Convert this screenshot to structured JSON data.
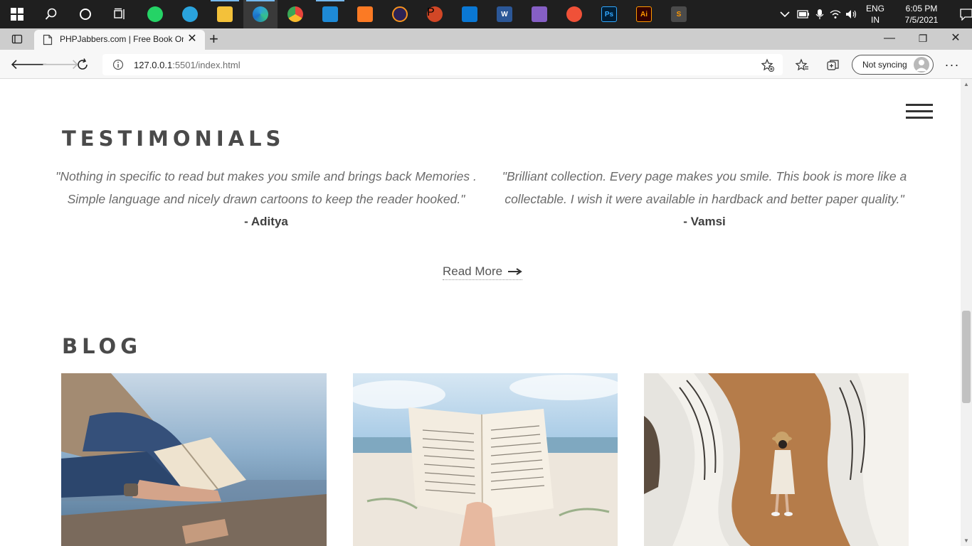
{
  "taskbar": {
    "apps": [
      {
        "name": "windows-start-icon"
      },
      {
        "name": "search-icon"
      },
      {
        "name": "cortana-icon"
      },
      {
        "name": "task-view-icon"
      },
      {
        "name": "whatsapp-icon",
        "color": "#25d366"
      },
      {
        "name": "telegram-icon",
        "color": "#2aa3dd"
      },
      {
        "name": "file-explorer-icon",
        "color": "#f3c13a"
      },
      {
        "name": "edge-icon",
        "color": "#2fa0d8"
      },
      {
        "name": "chrome-icon",
        "color": "#e8453c"
      },
      {
        "name": "vscode-icon",
        "color": "#1e8ad6"
      },
      {
        "name": "xampp-icon",
        "color": "#fb7a24"
      },
      {
        "name": "eclipse-icon",
        "color": "#2c2255"
      },
      {
        "name": "powerpoint-icon",
        "color": "#d24726",
        "glyph": "P"
      },
      {
        "name": "mail-icon",
        "color": "#0a78d4"
      },
      {
        "name": "word-icon",
        "color": "#2b5797",
        "glyph": "W"
      },
      {
        "name": "visual-studio-icon",
        "color": "#865fc5"
      },
      {
        "name": "swift-icon",
        "color": "#f05138"
      },
      {
        "name": "photoshop-icon",
        "color": "#001e36",
        "glyph": "Ps"
      },
      {
        "name": "illustrator-icon",
        "color": "#330000",
        "glyph": "Ai"
      },
      {
        "name": "sublime-icon",
        "color": "#4b4b4b",
        "glyph": "S"
      }
    ],
    "tray": {
      "lang_top": "ENG",
      "lang_bottom": "IN",
      "time": "6:05 PM",
      "date": "7/5/2021"
    }
  },
  "browser": {
    "tab_title": "PHPJabbers.com | Free Book Onli",
    "url_host": "127.0.0.1",
    "url_rest": ":5501/index.html",
    "sync_label": "Not syncing"
  },
  "testimonials": {
    "heading": "TESTIMONIALS",
    "items": [
      {
        "line1": "\"Nothing in specific to read but makes you smile and brings back Memories .",
        "line2": "Simple language and nicely drawn cartoons to keep the reader hooked.\"",
        "author": "- Aditya"
      },
      {
        "line1": "\"Brilliant collection. Every page makes you smile. This book is more like a",
        "line2": "collectable. I wish it were available in hardback and better paper quality.\"",
        "author": "- Vamsi"
      }
    ],
    "read_more": "Read More"
  },
  "blog": {
    "heading": "BLOG"
  }
}
